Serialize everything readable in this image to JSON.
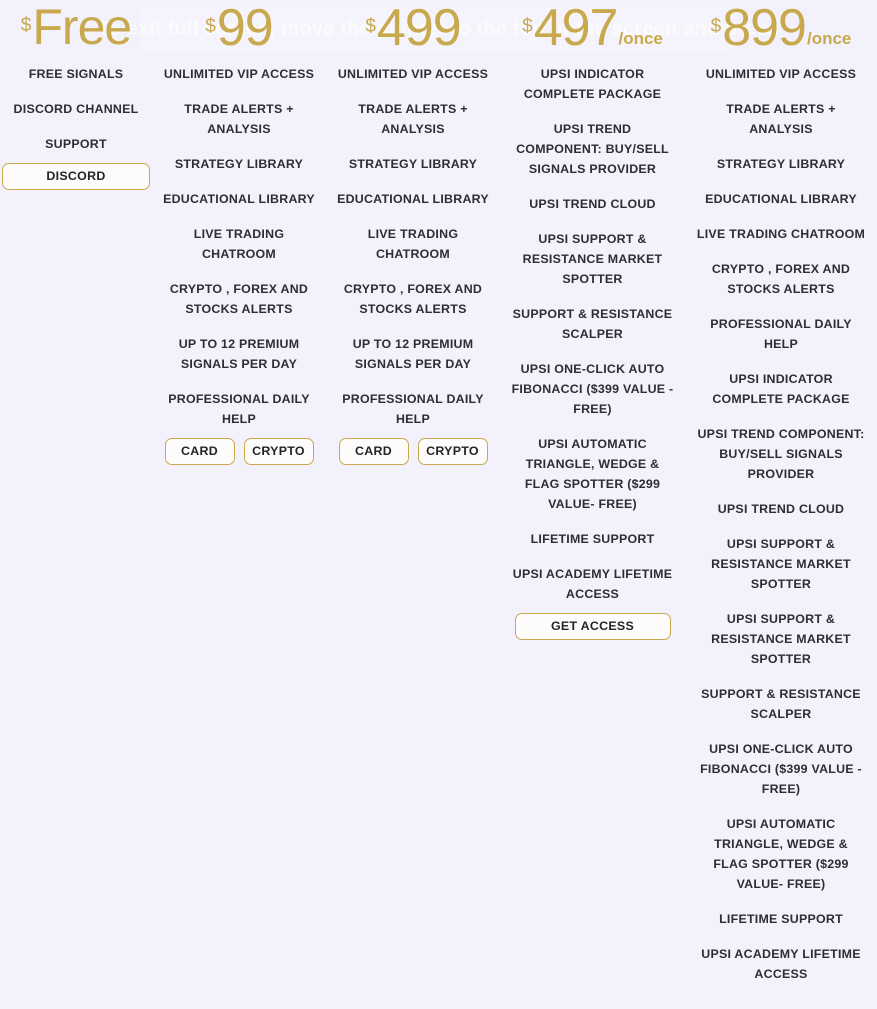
{
  "overlay": {
    "hint_text": "To exit full screen, move the pointer to the top of the screen and press",
    "visible": true
  },
  "theme": {
    "background": "#f3f1fb",
    "accent_gold": "#c9a94e",
    "text_dark": "#2d2d35",
    "button_bg": "#fdfcfa"
  },
  "plans": [
    {
      "currency": "$",
      "amount": "Free",
      "period": "",
      "features": [
        "FREE SIGNALS",
        "DISCORD CHANNEL",
        "SUPPORT"
      ],
      "buttons": [
        {
          "label": "DISCORD",
          "style": "wide"
        }
      ]
    },
    {
      "currency": "$",
      "amount": "99",
      "period": "",
      "features": [
        "UNLIMITED VIP ACCESS",
        "TRADE ALERTS + ANALYSIS",
        "STRATEGY LIBRARY",
        "EDUCATIONAL LIBRARY",
        "LIVE TRADING CHATROOM",
        "CRYPTO , FOREX AND STOCKS ALERTS",
        "UP TO 12 PREMIUM SIGNALS PER DAY",
        "PROFESSIONAL DAILY HELP"
      ],
      "buttons": [
        {
          "label": "CARD",
          "style": "half"
        },
        {
          "label": "CRYPTO",
          "style": "half"
        }
      ]
    },
    {
      "currency": "$",
      "amount": "499",
      "period": "",
      "features": [
        "UNLIMITED VIP ACCESS",
        "TRADE ALERTS + ANALYSIS",
        "STRATEGY LIBRARY",
        "EDUCATIONAL LIBRARY",
        "LIVE TRADING CHATROOM",
        "CRYPTO , FOREX AND STOCKS ALERTS",
        "UP TO 12 PREMIUM SIGNALS PER DAY",
        "PROFESSIONAL DAILY HELP"
      ],
      "buttons": [
        {
          "label": "CARD",
          "style": "half"
        },
        {
          "label": "CRYPTO",
          "style": "half"
        }
      ]
    },
    {
      "currency": "$",
      "amount": "497",
      "period": "/once",
      "features": [
        "UPSI INDICATOR COMPLETE PACKAGE",
        "UPSI TREND COMPONENT: BUY/SELL SIGNALS PROVIDER",
        "UPSI TREND CLOUD",
        "UPSI SUPPORT & RESISTANCE MARKET SPOTTER",
        "SUPPORT & RESISTANCE SCALPER",
        "UPSI ONE-CLICK AUTO FIBONACCI ($399 VALUE - FREE)",
        "UPSI AUTOMATIC TRIANGLE, WEDGE & FLAG SPOTTER ($299 VALUE- FREE)",
        "LIFETIME SUPPORT",
        "UPSI ACADEMY LIFETIME ACCESS"
      ],
      "buttons": [
        {
          "label": "GET ACCESS",
          "style": "access"
        }
      ]
    },
    {
      "currency": "$",
      "amount": "899",
      "period": "/once",
      "features": [
        "UNLIMITED VIP ACCESS",
        "TRADE ALERTS + ANALYSIS",
        "STRATEGY LIBRARY",
        "EDUCATIONAL LIBRARY",
        "LIVE TRADING CHATROOM",
        "CRYPTO , FOREX AND STOCKS ALERTS",
        "PROFESSIONAL DAILY HELP",
        "UPSI INDICATOR COMPLETE PACKAGE",
        "UPSI TREND COMPONENT: BUY/SELL SIGNALS PROVIDER",
        "UPSI TREND CLOUD",
        "UPSI SUPPORT & RESISTANCE MARKET SPOTTER",
        "UPSI SUPPORT & RESISTANCE MARKET SPOTTER",
        "SUPPORT & RESISTANCE SCALPER",
        "UPSI ONE-CLICK AUTO FIBONACCI ($399 VALUE - FREE)",
        "UPSI AUTOMATIC TRIANGLE, WEDGE & FLAG SPOTTER ($299 VALUE- FREE)",
        "LIFETIME SUPPORT",
        "UPSI ACADEMY LIFETIME ACCESS"
      ],
      "buttons": []
    }
  ]
}
